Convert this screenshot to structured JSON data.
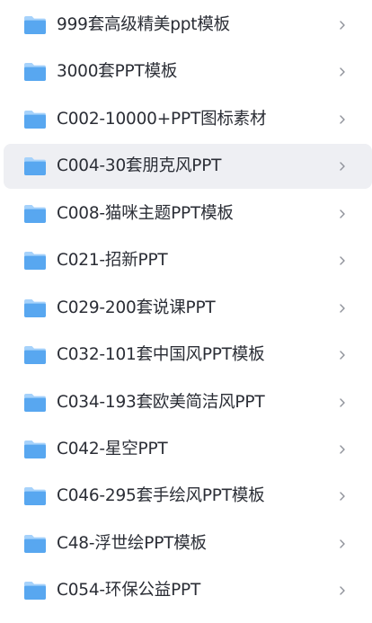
{
  "icons": {
    "folder": "folder-icon",
    "chevron": "chevron-right-icon"
  },
  "colors": {
    "folder_front": "#58a7f0",
    "folder_back": "#a6d2fb",
    "text": "#2b2e36",
    "chevron": "#8f929a",
    "selected_row_bg": "#eeeff3"
  },
  "selected_index": 3,
  "folders": [
    {
      "label": "999套高级精美ppt模板"
    },
    {
      "label": "3000套PPT模板"
    },
    {
      "label": "C002-10000+PPT图标素材"
    },
    {
      "label": "C004-30套朋克风PPT"
    },
    {
      "label": "C008-猫咪主题PPT模板"
    },
    {
      "label": "C021-招新PPT"
    },
    {
      "label": "C029-200套说课PPT"
    },
    {
      "label": "C032-101套中国风PPT模板"
    },
    {
      "label": "C034-193套欧美简洁风PPT"
    },
    {
      "label": "C042-星空PPT"
    },
    {
      "label": "C046-295套手绘风PPT模板"
    },
    {
      "label": "C48-浮世绘PPT模板"
    },
    {
      "label": "C054-环保公益PPT"
    }
  ]
}
